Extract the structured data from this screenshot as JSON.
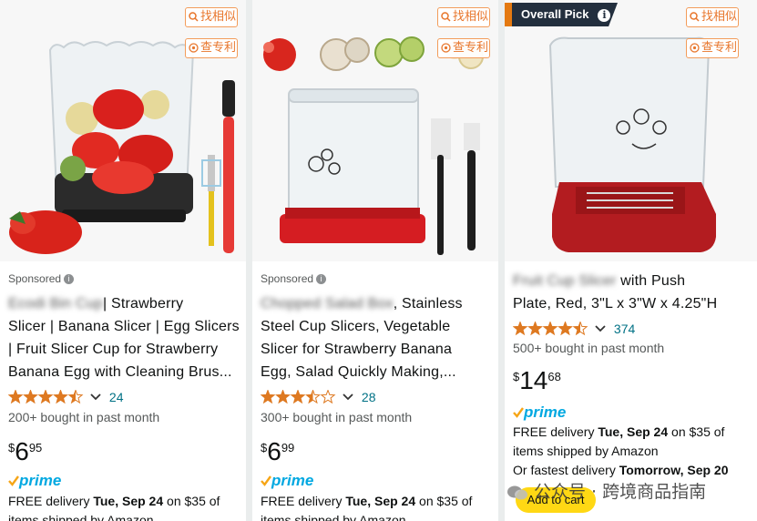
{
  "tags": {
    "find_similar": "找相似",
    "check_patent": "查专利"
  },
  "products": [
    {
      "badge": "",
      "sponsored": "Sponsored",
      "title_blurred": "Ecodi Bin Cup",
      "title_lines": [
        "| Strawberry",
        "Slicer | Banana Slicer | Egg Slicers",
        "| Fruit Slicer Cup for Strawberry",
        "Banana Egg with Cleaning Brus..."
      ],
      "rating": 4.5,
      "review_count": "24",
      "bought": "200+ bought in past month",
      "price_symbol": "$",
      "price_whole": "6",
      "price_fraction": "95",
      "prime": "prime",
      "delivery_prefix": "FREE delivery ",
      "delivery_date": "Tue, Sep 24",
      "delivery_suffix": " on $35 of",
      "delivery_line2": "items shipped by Amazon"
    },
    {
      "badge": "",
      "sponsored": "Sponsored",
      "title_blurred": "Chopped Salad Box",
      "title_lines": [
        ", Stainless",
        "Steel Cup Slicers, Vegetable",
        "Slicer for Strawberry Banana",
        "Egg, Salad Quickly Making,..."
      ],
      "rating": 3.5,
      "review_count": "28",
      "bought": "300+ bought in past month",
      "price_symbol": "$",
      "price_whole": "6",
      "price_fraction": "99",
      "prime": "prime",
      "delivery_prefix": "FREE delivery ",
      "delivery_date": "Tue, Sep 24",
      "delivery_suffix": " on $35 of",
      "delivery_line2": "items shipped by Amazon"
    },
    {
      "badge": "Overall Pick",
      "sponsored": "",
      "title_blurred": "Fruit Cup Slicer",
      "title_lines": [
        " with Push",
        "Plate, Red, 3\"L x 3\"W x 4.25\"H"
      ],
      "rating": 4.5,
      "review_count": "374",
      "bought": "500+ bought in past month",
      "price_symbol": "$",
      "price_whole": "14",
      "price_fraction": "68",
      "prime": "prime",
      "delivery_prefix": "FREE delivery ",
      "delivery_date": "Tue, Sep 24",
      "delivery_suffix": " on $35 of",
      "delivery_line2": "items shipped by Amazon",
      "fast_prefix": "Or fastest delivery ",
      "fast_date": "Tomorrow, Sep 20",
      "cart": "Add to cart"
    }
  ],
  "watermark": "公众号 · 跨境商品指南",
  "colors": {
    "star": "#de7921",
    "link": "#007185",
    "prime": "#00a8e1",
    "cart": "#ffd814",
    "tag": "#e8762c",
    "badge": "#232f3e"
  }
}
